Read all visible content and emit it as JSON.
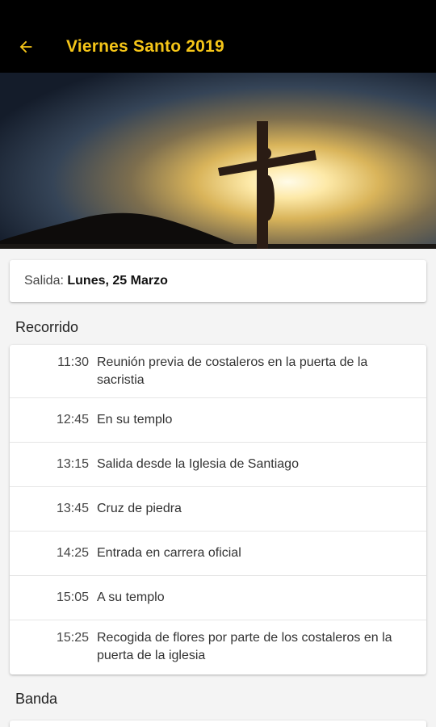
{
  "appbar": {
    "title": "Viernes Santo 2019",
    "back_icon": "arrow-left-icon",
    "accent_color": "#f5c518"
  },
  "hero": {
    "image": "cross-silhouette-sunset"
  },
  "salida": {
    "label": "Salida:",
    "value": "Lunes, 25 Marzo"
  },
  "recorrido": {
    "title": "Recorrido",
    "items": [
      {
        "time": "11:30",
        "text": "Reunión previa de costaleros en la puerta de la sacristia"
      },
      {
        "time": "12:45",
        "text": "En su templo"
      },
      {
        "time": "13:15",
        "text": "Salida desde la Iglesia de Santiago"
      },
      {
        "time": "13:45",
        "text": "Cruz de piedra"
      },
      {
        "time": "14:25",
        "text": "Entrada en carrera oficial"
      },
      {
        "time": "15:05",
        "text": "A su templo"
      },
      {
        "time": "15:25",
        "text": "Recogida de flores por parte de los costaleros en la puerta de la iglesia"
      }
    ]
  },
  "banda": {
    "title": "Banda"
  }
}
